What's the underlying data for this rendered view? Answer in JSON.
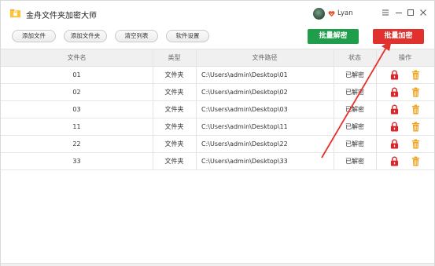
{
  "app": {
    "title": "金舟文件夹加密大师",
    "user_name": "Lyan",
    "icons": {
      "logo": "folder-lock-icon",
      "vip": "vip-heart-icon",
      "menu": "menu-icon",
      "minimize": "minimize-icon",
      "maximize": "maximize-icon",
      "close": "close-icon"
    }
  },
  "toolbar": {
    "add_file": "添加文件",
    "add_folder": "添加文件夹",
    "clear_list": "清空列表",
    "settings": "软件设置",
    "batch_decrypt": "批量解密",
    "batch_encrypt": "批量加密"
  },
  "table": {
    "headers": {
      "name": "文件名",
      "type": "类型",
      "path": "文件路径",
      "status": "状态",
      "action": "操作"
    },
    "rows": [
      {
        "name": "01",
        "type": "文件夹",
        "path": "C:\\Users\\admin\\Desktop\\01",
        "status": "已解密"
      },
      {
        "name": "02",
        "type": "文件夹",
        "path": "C:\\Users\\admin\\Desktop\\02",
        "status": "已解密"
      },
      {
        "name": "03",
        "type": "文件夹",
        "path": "C:\\Users\\admin\\Desktop\\03",
        "status": "已解密"
      },
      {
        "name": "11",
        "type": "文件夹",
        "path": "C:\\Users\\admin\\Desktop\\11",
        "status": "已解密"
      },
      {
        "name": "22",
        "type": "文件夹",
        "path": "C:\\Users\\admin\\Desktop\\22",
        "status": "已解密"
      },
      {
        "name": "33",
        "type": "文件夹",
        "path": "C:\\Users\\admin\\Desktop\\33",
        "status": "已解密"
      }
    ],
    "row_icons": {
      "lock": "lock-icon",
      "delete": "trash-icon"
    }
  },
  "colors": {
    "decrypt_green": "#1e9e4a",
    "encrypt_red": "#e1312f",
    "lock_red": "#d9262c",
    "trash_orange": "#f0a21c",
    "annotation_red": "#e3342c"
  }
}
